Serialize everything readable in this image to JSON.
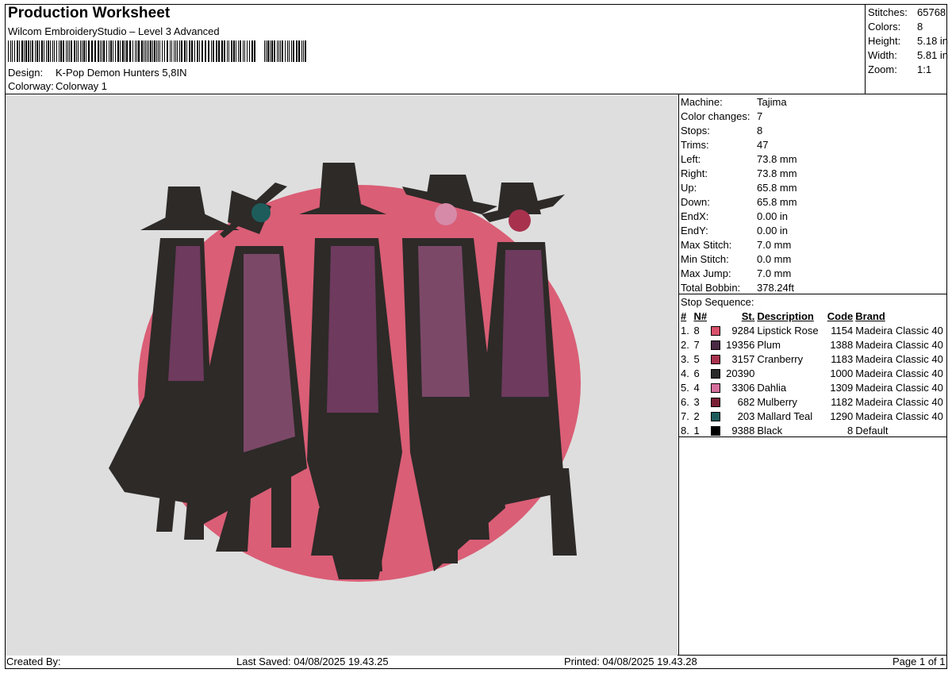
{
  "header": {
    "title": "Production Worksheet",
    "software": "Wilcom EmbroideryStudio – Level 3 Advanced",
    "design_label": "Design:",
    "design_value": "K-Pop Demon Hunters 5,8IN",
    "colorway_label": "Colorway:",
    "colorway_value": "Colorway 1"
  },
  "summary": [
    {
      "label": "Stitches:",
      "value": "65768"
    },
    {
      "label": "Colors:",
      "value": "8"
    },
    {
      "label": "Height:",
      "value": "5.18 in"
    },
    {
      "label": "Width:",
      "value": "5.81 in"
    },
    {
      "label": "Zoom:",
      "value": "1:1"
    }
  ],
  "machine_params": [
    {
      "label": "Machine:",
      "value": "Tajima"
    },
    {
      "label": "Color changes:",
      "value": "7"
    },
    {
      "label": "Stops:",
      "value": "8"
    },
    {
      "label": "Trims:",
      "value": "47"
    },
    {
      "label": "Left:",
      "value": "73.8 mm"
    },
    {
      "label": "Right:",
      "value": "73.8 mm"
    },
    {
      "label": "Up:",
      "value": "65.8 mm"
    },
    {
      "label": "Down:",
      "value": "65.8 mm"
    },
    {
      "label": "EndX:",
      "value": "0.00 in"
    },
    {
      "label": "EndY:",
      "value": "0.00 in"
    },
    {
      "label": "Max Stitch:",
      "value": "7.0 mm"
    },
    {
      "label": "Min Stitch:",
      "value": "0.0 mm"
    },
    {
      "label": "Max Jump:",
      "value": "7.0 mm"
    },
    {
      "label": "Total Bobbin:",
      "value": "378.24ft"
    }
  ],
  "stop_sequence": {
    "caption": "Stop Sequence:",
    "columns": {
      "idx": "#",
      "num": "N#",
      "st": "St.",
      "desc": "Description",
      "code": "Code",
      "brand": "Brand"
    },
    "rows": [
      {
        "idx": "1.",
        "num": "8",
        "color": "#d9506a",
        "st": "9284",
        "desc": "Lipstick Rose",
        "code": "1154",
        "brand": "Madeira Classic 40"
      },
      {
        "idx": "2.",
        "num": "7",
        "color": "#4a2a45",
        "st": "19356",
        "desc": "Plum",
        "code": "1388",
        "brand": "Madeira Classic 40"
      },
      {
        "idx": "3.",
        "num": "5",
        "color": "#a8324e",
        "st": "3157",
        "desc": "Cranberry",
        "code": "1183",
        "brand": "Madeira Classic 40"
      },
      {
        "idx": "4.",
        "num": "6",
        "color": "#2a2a2a",
        "st": "20390",
        "desc": "",
        "code": "1000",
        "brand": "Madeira Classic 40"
      },
      {
        "idx": "5.",
        "num": "4",
        "color": "#d46f9c",
        "st": "3306",
        "desc": "Dahlia",
        "code": "1309",
        "brand": "Madeira Classic 40"
      },
      {
        "idx": "6.",
        "num": "3",
        "color": "#7a2035",
        "st": "682",
        "desc": "Mulberry",
        "code": "1182",
        "brand": "Madeira Classic 40"
      },
      {
        "idx": "7.",
        "num": "2",
        "color": "#1e5c5c",
        "st": "203",
        "desc": "Mallard Teal",
        "code": "1290",
        "brand": "Madeira Classic 40"
      },
      {
        "idx": "8.",
        "num": "1",
        "color": "#000000",
        "st": "9388",
        "desc": "Black",
        "code": "8",
        "brand": "Default"
      }
    ]
  },
  "footer": {
    "created_by": "Created By:",
    "last_saved": "Last Saved: 04/08/2025 19.43.25",
    "printed": "Printed: 04/08/2025 19.43.28",
    "page": "Page 1 of 1"
  }
}
